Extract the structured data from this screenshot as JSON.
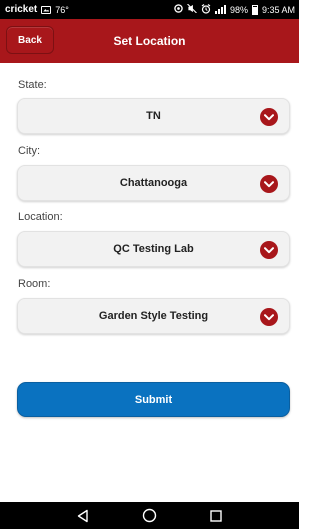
{
  "status_bar": {
    "carrier": "cricket",
    "temperature": "76°",
    "battery": "98%",
    "time": "9:35 AM"
  },
  "header": {
    "back_label": "Back",
    "title": "Set Location",
    "color": "#a8171b"
  },
  "form": {
    "fields": [
      {
        "label": "State:",
        "value": "TN"
      },
      {
        "label": "City:",
        "value": "Chattanooga"
      },
      {
        "label": "Location:",
        "value": "QC Testing Lab"
      },
      {
        "label": "Room:",
        "value": "Garden Style Testing"
      }
    ],
    "submit_label": "Submit",
    "submit_color": "#0a72c0"
  },
  "nav_bar": {
    "icons": [
      "back-triangle-icon",
      "home-circle-icon",
      "recents-square-icon"
    ]
  }
}
